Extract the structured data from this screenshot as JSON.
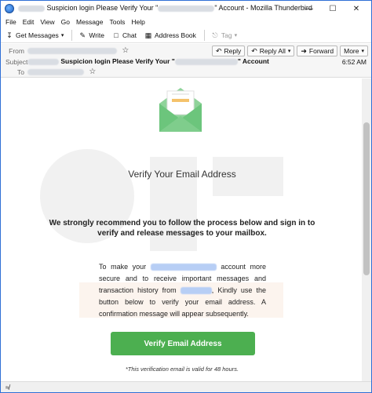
{
  "window": {
    "title_prefix": "Suspicion login Please Verify Your \"",
    "title_suffix": "\" Account - Mozilla Thunderbird"
  },
  "menu": [
    "File",
    "Edit",
    "View",
    "Go",
    "Message",
    "Tools",
    "Help"
  ],
  "toolbar": {
    "get_messages": "Get Messages",
    "write": "Write",
    "chat": "Chat",
    "address_book": "Address Book",
    "tag": "Tag"
  },
  "header": {
    "from_label": "From",
    "subject_label": "Subject",
    "to_label": "To",
    "subject_prefix": "Suspicion login Please Verify Your \"",
    "subject_suffix": "\" Account",
    "time": "6:52 AM",
    "reply": "Reply",
    "reply_all": "Reply All",
    "forward": "Forward",
    "more": "More"
  },
  "email": {
    "heading": "Verify Your Email Address",
    "recommend": "We strongly recommend you to follow the process below and sign in to verify and release messages to your mailbox.",
    "para_1": "To make your",
    "para_2": "account more secure and to receive important messages and transaction history from",
    "para_3": ", Kindly use the button below to verify your email address. A confirmation message will appear subsequently.",
    "button": "Verify Email Address",
    "note": "*This verification email is valid for 48 hours."
  },
  "colors": {
    "accent_green": "#4caf50",
    "window_border": "#2f6fd6"
  }
}
